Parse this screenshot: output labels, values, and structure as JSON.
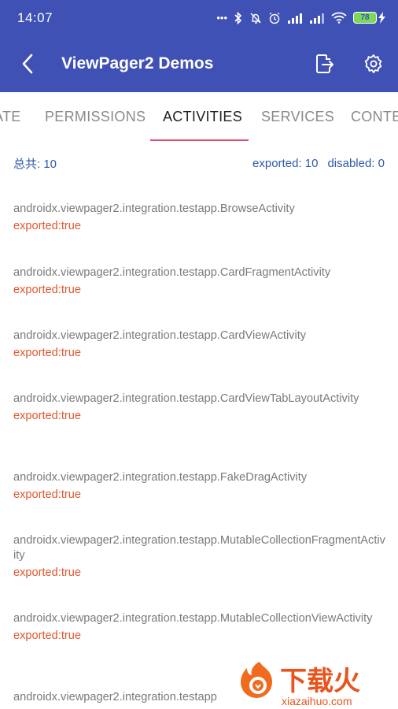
{
  "status": {
    "time": "14:07",
    "battery": "78"
  },
  "appbar": {
    "title": "ViewPager2 Demos",
    "icons": [
      "back-arrow-icon",
      "export-icon",
      "settings-gear-icon"
    ]
  },
  "tabs": [
    {
      "label": "ATE"
    },
    {
      "label": "PERMISSIONS"
    },
    {
      "label": "ACTIVITIES"
    },
    {
      "label": "SERVICES"
    },
    {
      "label": "CONTE"
    }
  ],
  "summary": {
    "total": "总共: 10",
    "exported": "exported: 10",
    "disabled": "disabled: 0"
  },
  "items": [
    {
      "name": "androidx.viewpager2.integration.testapp.BrowseActivity",
      "flag": "exported:true"
    },
    {
      "name": "androidx.viewpager2.integration.testapp.CardFragmentActivity",
      "flag": "exported:true"
    },
    {
      "name": "androidx.viewpager2.integration.testapp.CardViewActivity",
      "flag": "exported:true"
    },
    {
      "name": "androidx.viewpager2.integration.testapp.CardViewTabLayoutActivity",
      "flag": "exported:true"
    },
    {
      "name": "androidx.viewpager2.integration.testapp.FakeDragActivity",
      "flag": "exported:true"
    },
    {
      "name": "androidx.viewpager2.integration.testapp.MutableCollectionFragmentActivity",
      "flag": "exported:true"
    },
    {
      "name": "androidx.viewpager2.integration.testapp.MutableCollectionViewActivity",
      "flag": "exported:true"
    },
    {
      "name": "androidx.viewpager2.integration.testapp",
      "flag": ""
    }
  ],
  "watermark": {
    "brand": "下载火",
    "domain": "xiazaihuo.com"
  }
}
